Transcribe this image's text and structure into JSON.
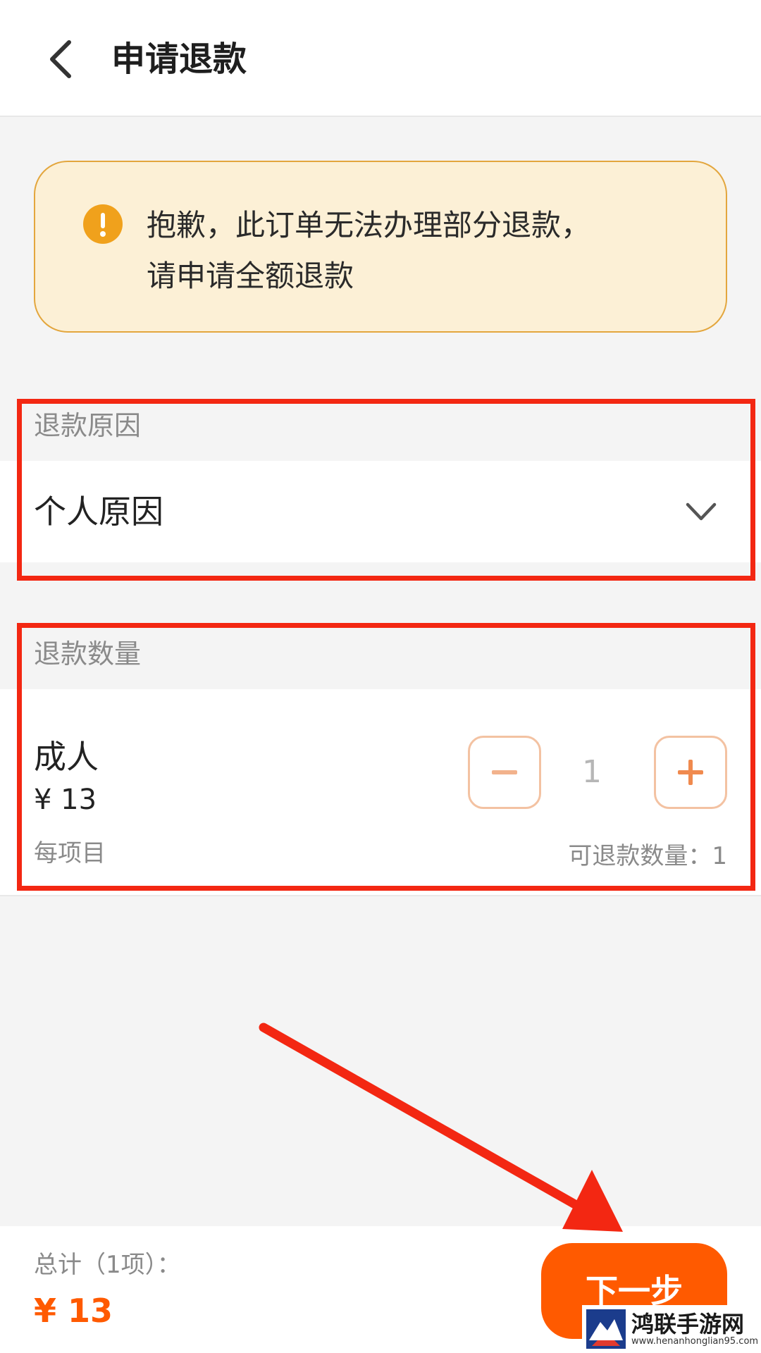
{
  "header": {
    "back_icon": "chevron-left-icon",
    "title": "申请退款"
  },
  "alert": {
    "icon": "exclamation-circle-icon",
    "line1": "抱歉，此订单无法办理部分退款，",
    "line2": "请申请全额退款",
    "colors": {
      "background": "#fcf0d6",
      "border": "#e3a63d",
      "icon": "#f0a11c"
    }
  },
  "refund_reason": {
    "label": "退款原因",
    "value": "个人原因",
    "dropdown_icon": "chevron-down-icon"
  },
  "refund_quantity": {
    "label": "退款数量",
    "item": {
      "name": "成人",
      "price": "¥ 13",
      "unit": "每项目"
    },
    "stepper": {
      "minus_icon": "minus-icon",
      "value": "1",
      "plus_icon": "plus-icon"
    },
    "refundable": "可退款数量：1"
  },
  "footer": {
    "total_label": "总计（1项）：",
    "total_amount": "¥ 13",
    "next_label": "下一步",
    "accent_color": "#ff5a00"
  },
  "annotation_color": "#f32712",
  "watermark": {
    "name": "鸿联手游网",
    "url": "www.henanhonglian95.com"
  }
}
